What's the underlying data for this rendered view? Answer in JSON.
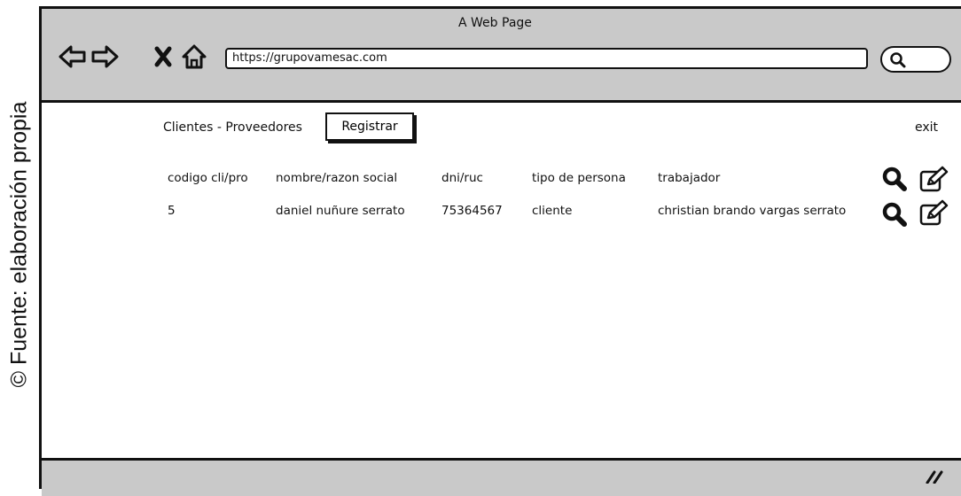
{
  "caption": "© Fuente: elaboración propia",
  "window": {
    "title": "A Web Page"
  },
  "browser": {
    "url": "https://grupovamesac.com",
    "icons": [
      "back-arrow-icon",
      "forward-arrow-icon",
      "close-x-icon",
      "home-icon",
      "search-icon",
      "resize-grip-icon"
    ]
  },
  "page": {
    "heading": "Clientes - Proveedores",
    "register_label": "Registrar",
    "exit_label": "exit"
  },
  "table": {
    "headers": {
      "code": "codigo cli/pro",
      "name": "nombre/razon social",
      "doc": "dni/ruc",
      "type": "tipo de persona",
      "worker": "trabajador"
    },
    "rows": [
      {
        "code": "5",
        "name": "daniel nuñure serrato",
        "doc": "75364567",
        "type": "cliente",
        "worker": "christian brando vargas serrato"
      }
    ],
    "actions": [
      "view-icon",
      "edit-icon"
    ]
  },
  "colors": {
    "chrome": "#c9c9c9",
    "ink": "#111111",
    "page": "#ffffff"
  }
}
